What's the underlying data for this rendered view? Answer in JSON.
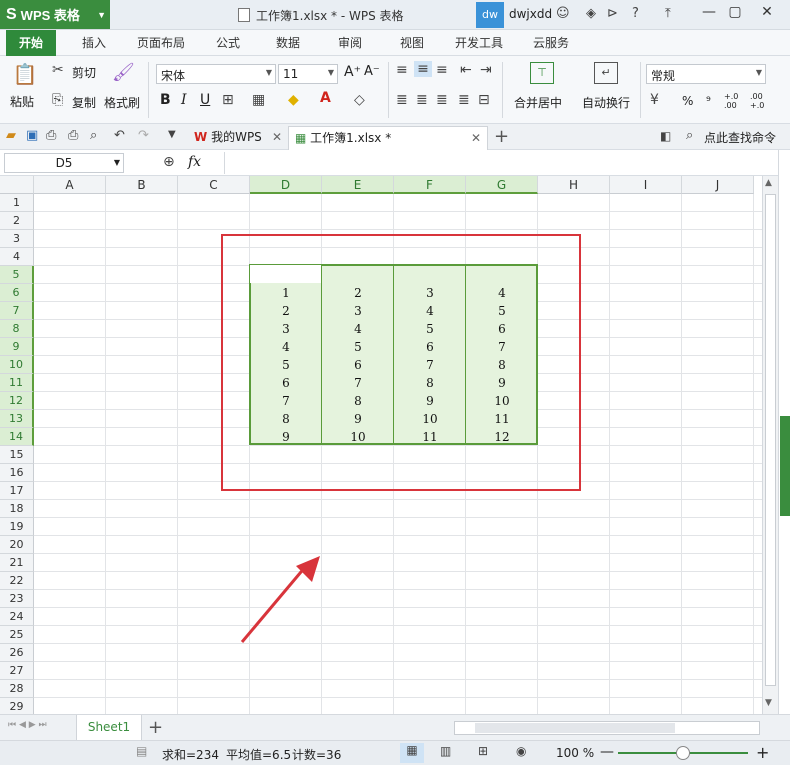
{
  "app": {
    "name": "WPS 表格",
    "logo_glyph": "S",
    "doc_title": "工作簿1.xlsx * - WPS 表格",
    "user_initials": "dw",
    "user_name": "dwjxdd"
  },
  "menu_tabs": [
    "开始",
    "插入",
    "页面布局",
    "公式",
    "数据",
    "审阅",
    "视图",
    "开发工具",
    "云服务"
  ],
  "ribbon": {
    "paste": "粘贴",
    "cut": "剪切",
    "copy": "复制",
    "format_painter": "格式刷",
    "font_name": "宋体",
    "font_size": "11",
    "bold": "B",
    "italic": "I",
    "underline": "U",
    "font_grow": "A⁺",
    "font_shrink": "A⁻",
    "merge_center": "合并居中",
    "wrap_text": "自动换行",
    "number_format": "常规",
    "percent": "%",
    "comma": "⁹",
    "inc_decimal": "+.0 .00",
    "dec_decimal": ".00 +.0"
  },
  "quickbar": {
    "my_wps": "我的WPS",
    "doc_tab": "工作簿1.xlsx *",
    "search_cmd": "点此查找命令"
  },
  "formula_bar": {
    "name_box": "D5",
    "fx": "fx",
    "formula": ""
  },
  "columns": [
    "A",
    "B",
    "C",
    "D",
    "E",
    "F",
    "G",
    "H",
    "I",
    "J"
  ],
  "rows": [
    "1",
    "2",
    "3",
    "4",
    "5",
    "6",
    "7",
    "8",
    "9",
    "10",
    "11",
    "12",
    "13",
    "14",
    "15",
    "16",
    "17",
    "18",
    "19",
    "20",
    "21",
    "22",
    "23",
    "24",
    "25",
    "26",
    "27",
    "28",
    "29"
  ],
  "selected_columns": [
    "D",
    "E",
    "F",
    "G"
  ],
  "selected_rows": [
    "5",
    "6",
    "7",
    "8",
    "9",
    "10",
    "11",
    "12",
    "13",
    "14"
  ],
  "table": [
    [
      "1",
      "2",
      "3",
      "4"
    ],
    [
      "2",
      "3",
      "4",
      "5"
    ],
    [
      "3",
      "4",
      "5",
      "6"
    ],
    [
      "4",
      "5",
      "6",
      "7"
    ],
    [
      "5",
      "6",
      "7",
      "8"
    ],
    [
      "6",
      "7",
      "8",
      "9"
    ],
    [
      "7",
      "8",
      "9",
      "10"
    ],
    [
      "8",
      "9",
      "10",
      "11"
    ],
    [
      "9",
      "10",
      "11",
      "12"
    ]
  ],
  "sheets": {
    "active": "Sheet1",
    "add": "+"
  },
  "status": {
    "sum": "求和=234",
    "avg": "平均值=6.5",
    "count": "计数=36",
    "zoom": "100 %"
  },
  "colors": {
    "accent": "#2f8a3b",
    "selection_fill": "#e5f3dd",
    "selection_border": "#5a9b3a",
    "annotation": "#d8343b"
  }
}
